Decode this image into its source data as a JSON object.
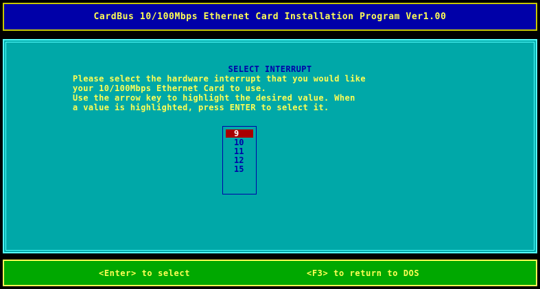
{
  "title_bar": {
    "text": "CardBus 10/100Mbps Ethernet Card Installation Program Ver1.00"
  },
  "main": {
    "section_title": "SELECT INTERRUPT",
    "instructions": [
      "Please select the hardware interrupt that you would like",
      "your 10/100Mbps Ethernet Card to use.",
      "Use the arrow key to highlight the desired value. When",
      "a value is highlighted, press ENTER to select it."
    ],
    "irq_options": [
      "9",
      "10",
      "11",
      "12",
      "15"
    ],
    "selected_irq": "9"
  },
  "footer": {
    "enter_hint": "<Enter> to select",
    "f3_hint": "<F3> to return to DOS"
  },
  "colors": {
    "title_background": "#0000a8",
    "panel_background": "#00a8a8",
    "footer_background": "#00a800",
    "highlight": "#a80000",
    "accent_text": "#ffff55"
  }
}
